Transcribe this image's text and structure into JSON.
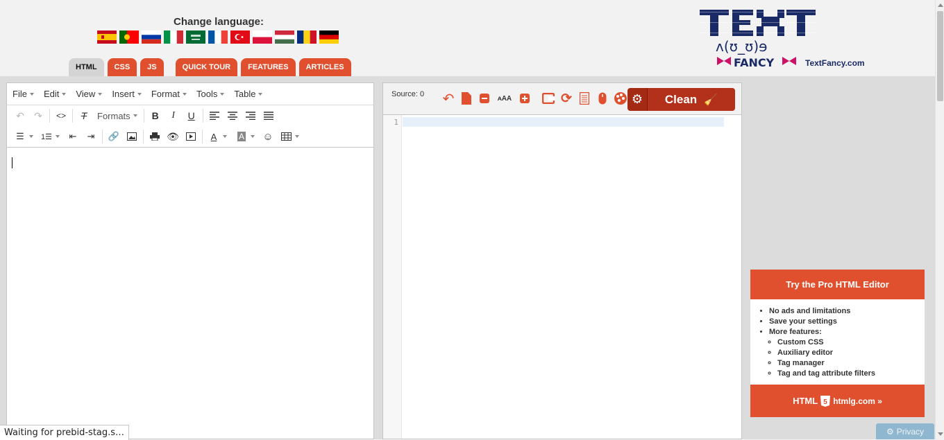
{
  "header": {
    "change_language": "Change language:",
    "flags": [
      "es-flag-icon",
      "pt-flag-icon",
      "ru-flag-icon",
      "it-flag-icon",
      "sa-flag-icon",
      "fr-flag-icon",
      "tr-flag-icon",
      "pl-flag-icon",
      "hu-flag-icon",
      "ro-flag-icon",
      "de-flag-icon"
    ],
    "logo_text": "TextFancy.com"
  },
  "tabs": [
    {
      "label": "HTML",
      "active": true
    },
    {
      "label": "CSS"
    },
    {
      "label": "JS"
    },
    {
      "label": "QUICK TOUR"
    },
    {
      "label": "FEATURES"
    },
    {
      "label": "ARTICLES"
    }
  ],
  "editor": {
    "menus": [
      "File",
      "Edit",
      "View",
      "Insert",
      "Format",
      "Tools",
      "Table"
    ],
    "formats_label": "Formats"
  },
  "source": {
    "count_label": "Source: 0",
    "clean_label": "Clean",
    "line_number": "1"
  },
  "ad": {
    "title": "Try the Pro HTML Editor",
    "items": [
      "No ads and limitations",
      "Save your settings",
      "More features:"
    ],
    "subitems": [
      "Custom CSS",
      "Auxiliary editor",
      "Tag manager",
      "Tag and tag attribute filters"
    ],
    "footer_brand": "HTML",
    "footer_link": "htmlg.com »"
  },
  "status_text": "Waiting for prebid-stag.s…",
  "privacy_label": "Privacy",
  "colors": {
    "accent": "#e0502e",
    "clean": "#b3301a",
    "background": "#f2f2f2"
  }
}
